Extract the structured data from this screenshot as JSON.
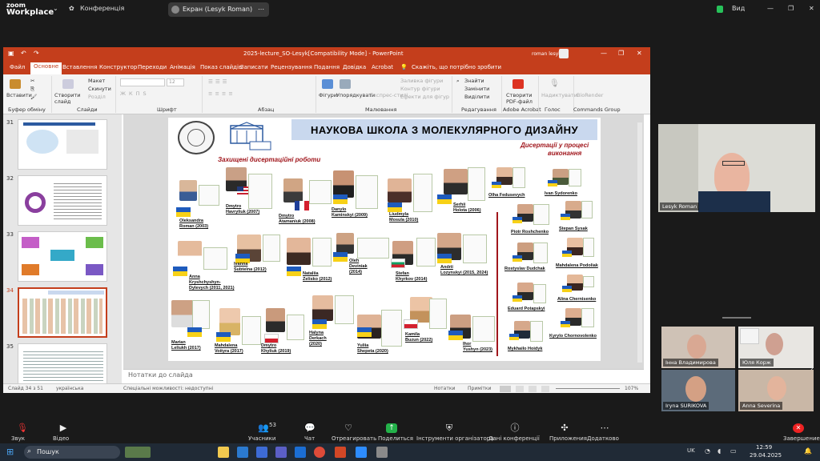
{
  "zoom": {
    "logo_line1": "zoom",
    "logo_line2": "Workplace",
    "conference_label": "Конференція",
    "share_label": "Екран (Lesyk Roman)",
    "view_label": "Вид"
  },
  "ppt": {
    "title": "2025-lecture_SO-Lesyk[Compatibility Mode] - PowerPoint",
    "user": "roman lesyk",
    "menu": [
      "Файл",
      "Основне",
      "Вставлення",
      "Конструктор",
      "Переходи",
      "Анімація",
      "Показ слайдів",
      "Записати",
      "Рецензування",
      "Подання",
      "Довідка",
      "Acrobat",
      "Скажіть, що потрібно зробити"
    ],
    "ribbon": {
      "paste": "Вставити",
      "clipboard": "Буфер обміну",
      "new_slide": "Створити слайд",
      "layout": "Макет",
      "reset": "Скинути",
      "sections": "Розділ",
      "slides": "Слайди",
      "font_size": "12",
      "font": "Шрифт",
      "paragraph": "Абзац",
      "shapes": "Фігури",
      "arrange": "Упорядкувати",
      "quick_styles": "Експрес-стилі",
      "fill": "Заливка фігури",
      "outline": "Контур фігури",
      "effects": "Ефекти для фігур",
      "drawing": "Малювання",
      "find": "Знайти",
      "replace": "Замінити",
      "select": "Виділити",
      "editing": "Редагування",
      "create_pdf": "Створити PDF-файл",
      "adobe": "Adobe Acrobat",
      "dictate": "Надиктувати",
      "voice": "Голос",
      "biorender": "BioRender",
      "commands": "Commands Group"
    },
    "thumbs": [
      "31",
      "32",
      "33",
      "34",
      "35"
    ],
    "notes_placeholder": "Нотатки до слайда",
    "status": {
      "slide": "Слайд 34 з 51",
      "lang": "українська",
      "accessibility": "Спеціальні можливості: недоступні",
      "notes": "Нотатки",
      "comments": "Примітки",
      "zoom": "107%"
    }
  },
  "slide": {
    "title": "НАУКОВА ШКОЛА З МОЛЕКУЛЯРНОГО ДИЗАЙНУ",
    "left_heading": "Захищені дисертаційні роботи",
    "right_heading_1": "Дисертації у процесі",
    "right_heading_2": "виконання",
    "defended": [
      {
        "name": "Oleksandra",
        "name2": "Roman (2003)"
      },
      {
        "name": "Dmytro",
        "name2": "Havryliuk (2007)"
      },
      {
        "name": "Dmytro",
        "name2": "Atamaniuk (2008)"
      },
      {
        "name": "Danylo",
        "name2": "Kaminskyi (2009)"
      },
      {
        "name": "Liudmyla",
        "name2": "Mosula (2010)"
      },
      {
        "name": "Serhii",
        "name2": "Holota (2006)"
      },
      {
        "name": "Anna",
        "name2": "Kryshchyshyn-",
        "name3": "Dylevych (2011, 2021)"
      },
      {
        "name": "Ivanna",
        "name2": "Subtelna (2012)"
      },
      {
        "name": "Nataliia",
        "name2": "Zelisko (2012)"
      },
      {
        "name": "Oleh",
        "name2": "Deviniak",
        "name3": "(2014)"
      },
      {
        "name": "Stefan",
        "name2": "Khyrkov (2014)"
      },
      {
        "name": "Andrii",
        "name2": "Lozynskyi (2015, 2024)"
      },
      {
        "name": "Marian",
        "name2": "Leliukh (2017)"
      },
      {
        "name": "Mahdalena",
        "name2": "Voityra (2017)"
      },
      {
        "name": "Dmytro",
        "name2": "Khyliuk (2019)"
      },
      {
        "name": "Halyna",
        "name2": "Derkach",
        "name3": "(2020)"
      },
      {
        "name": "Yuliia",
        "name2": "Shepeta (2020)"
      },
      {
        "name": "Kamila",
        "name2": "Buzun (2022)"
      },
      {
        "name": "Ihor",
        "name2": "Yushyn (2023)"
      }
    ],
    "in_progress": [
      {
        "name": "Olha Fedusevych"
      },
      {
        "name": "Ivan Sydorenko"
      },
      {
        "name": "Piotr Roshchenko"
      },
      {
        "name": "Stepan Sysak"
      },
      {
        "name": "Rostyslav Dudchak"
      },
      {
        "name": "Mahdalena Podoliak"
      },
      {
        "name": "Alina Chernisenko"
      },
      {
        "name": "Eduard Potapskyi"
      },
      {
        "name": "Mykhailo Hoidyk"
      },
      {
        "name": "Kyrylo Chornovolenko"
      }
    ]
  },
  "participants": [
    {
      "name": "Lesyk Roman"
    },
    {
      "name": "Інна Владимирова"
    },
    {
      "name": "Юля Корж"
    },
    {
      "name": "Iryna SURIKOVA"
    },
    {
      "name": "Anna Severina"
    }
  ],
  "toolbar": {
    "audio": "Звук",
    "video": "Відео",
    "participants": "Учасники",
    "participants_count": "53",
    "chat": "Чат",
    "react": "Отреагировать",
    "share": "Поделиться",
    "host_tools": "Інструменти організатора",
    "meeting_info": "Дані конференції",
    "apps": "Приложения",
    "more": "Додатково",
    "end": "Завершение"
  },
  "taskbar": {
    "search": "Пошук",
    "lang": "UK",
    "time": "12:59",
    "date": "29.04.2025"
  },
  "colors": {
    "ppt_accent": "#c43e1c",
    "slide_title_bg": "#c9d8ee",
    "slide_red": "#a0161c"
  }
}
